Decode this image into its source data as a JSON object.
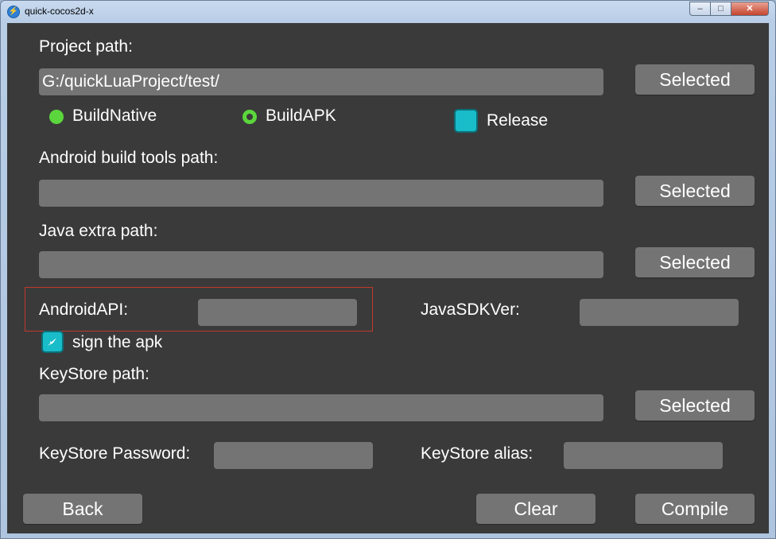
{
  "window": {
    "title": "quick-cocos2d-x",
    "min": "–",
    "max": "□",
    "close": "✕"
  },
  "form": {
    "project_path_label": "Project path:",
    "project_path_value": "G:/quickLuaProject/test/",
    "selected_label": "Selected",
    "build_native_label": "BuildNative",
    "build_apk_label": "BuildAPK",
    "release_label": "Release",
    "android_tools_label": "Android build tools path:",
    "android_tools_value": "",
    "java_extra_label": "Java extra path:",
    "java_extra_value": "",
    "android_api_label": "AndroidAPI:",
    "android_api_value": "",
    "java_sdk_label": "JavaSDKVer:",
    "java_sdk_value": "",
    "sign_apk_label": "sign the apk",
    "keystore_path_label": "KeyStore path:",
    "keystore_path_value": "",
    "keystore_password_label": "KeyStore Password:",
    "keystore_password_value": "",
    "keystore_alias_label": "KeyStore alias:",
    "keystore_alias_value": ""
  },
  "actions": {
    "back": "Back",
    "clear": "Clear",
    "compile": "Compile"
  },
  "colors": {
    "background": "#3a3a3a",
    "control": "#747474",
    "radio": "#5bd63c",
    "checkbox": "#19bcc9",
    "highlight": "#c0392b"
  }
}
